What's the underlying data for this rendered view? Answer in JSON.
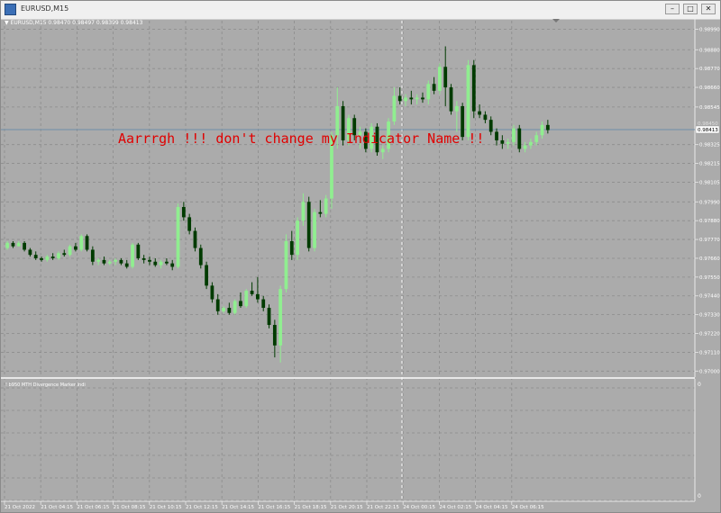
{
  "window": {
    "title": "EURUSD,M15",
    "min_label": "–",
    "max_label": "□",
    "close_label": "✕"
  },
  "chart_info": {
    "arrow": "▼",
    "text": "EURUSD,M15  0.98470 0.98497 0.98399 0.98413"
  },
  "message": "Aarrrgh !!! don't change my Indicator Name !!",
  "subwindow": {
    "title": "! b950 MTH Divergence Marker Indi",
    "scale_top": "0",
    "scale_bottom": "0"
  },
  "colors": {
    "background": "#ababab",
    "grid": "#8c8c8c",
    "bull": "#90ee90",
    "bear": "#003b00",
    "message": "#e00000",
    "price_line": "#6f8fa8"
  },
  "chart_data": {
    "type": "candlestick",
    "symbol": "EURUSD",
    "timeframe": "M15",
    "current_price": 0.98413,
    "price_tag_above": "0.98450",
    "yticks": [
      0.99,
      0.9888,
      0.9877,
      0.9866,
      0.98545,
      0.98325,
      0.98215,
      0.98105,
      0.9799,
      0.9788,
      0.9777,
      0.9766,
      0.9755,
      0.9744,
      0.9733,
      0.9722,
      0.9711,
      0.97
    ],
    "ytick_labels": [
      "0.98990",
      "0.98880",
      "0.98770",
      "0.98660",
      "0.98545",
      "0.98325",
      "0.98215",
      "0.98105",
      "0.97990",
      "0.97880",
      "0.97770",
      "0.97660",
      "0.97550",
      "0.97440",
      "0.97330",
      "0.97220",
      "0.97110",
      "0.97000"
    ],
    "ylim": [
      0.9697,
      0.9905
    ],
    "xticks": [
      "21 Oct 2022",
      "21 Oct 04:15",
      "21 Oct 06:15",
      "21 Oct 08:15",
      "21 Oct 10:15",
      "21 Oct 12:15",
      "21 Oct 14:15",
      "21 Oct 16:15",
      "21 Oct 18:15",
      "21 Oct 20:15",
      "21 Oct 22:15",
      "24 Oct 00:15",
      "24 Oct 02:15",
      "24 Oct 04:15",
      "24 Oct 06:15"
    ],
    "candles": [
      [
        0.9772,
        0.9776,
        0.9771,
        0.9775
      ],
      [
        0.9775,
        0.9776,
        0.9772,
        0.9773
      ],
      [
        0.9773,
        0.9776,
        0.9773,
        0.9775
      ],
      [
        0.9775,
        0.9776,
        0.977,
        0.9771
      ],
      [
        0.9771,
        0.9772,
        0.9767,
        0.9768
      ],
      [
        0.9768,
        0.977,
        0.9765,
        0.9766
      ],
      [
        0.9766,
        0.9767,
        0.9764,
        0.9765
      ],
      [
        0.9765,
        0.9768,
        0.9764,
        0.9767
      ],
      [
        0.9767,
        0.9769,
        0.9765,
        0.9766
      ],
      [
        0.9766,
        0.977,
        0.9765,
        0.9769
      ],
      [
        0.9769,
        0.9771,
        0.9767,
        0.9768
      ],
      [
        0.9768,
        0.9774,
        0.9767,
        0.9773
      ],
      [
        0.9773,
        0.9775,
        0.977,
        0.9771
      ],
      [
        0.9771,
        0.978,
        0.977,
        0.9779
      ],
      [
        0.9779,
        0.978,
        0.977,
        0.9771
      ],
      [
        0.9771,
        0.9773,
        0.9762,
        0.9764
      ],
      [
        0.9764,
        0.9766,
        0.9762,
        0.9765
      ],
      [
        0.9765,
        0.9767,
        0.9762,
        0.9763
      ],
      [
        0.9763,
        0.9765,
        0.9762,
        0.9764
      ],
      [
        0.9764,
        0.9766,
        0.9762,
        0.9765
      ],
      [
        0.9765,
        0.9766,
        0.9762,
        0.9763
      ],
      [
        0.9763,
        0.9765,
        0.976,
        0.9761
      ],
      [
        0.9761,
        0.9775,
        0.976,
        0.9774
      ],
      [
        0.9774,
        0.9775,
        0.9765,
        0.9766
      ],
      [
        0.9766,
        0.9768,
        0.9763,
        0.9765
      ],
      [
        0.9765,
        0.9767,
        0.9762,
        0.9764
      ],
      [
        0.9764,
        0.9766,
        0.9761,
        0.9762
      ],
      [
        0.9762,
        0.9765,
        0.976,
        0.9764
      ],
      [
        0.9764,
        0.9766,
        0.9762,
        0.9763
      ],
      [
        0.9763,
        0.9765,
        0.9759,
        0.9761
      ],
      [
        0.9761,
        0.9798,
        0.976,
        0.9796
      ],
      [
        0.9796,
        0.9799,
        0.9788,
        0.979
      ],
      [
        0.979,
        0.9792,
        0.978,
        0.9782
      ],
      [
        0.9782,
        0.9784,
        0.977,
        0.9772
      ],
      [
        0.9772,
        0.9774,
        0.976,
        0.9762
      ],
      [
        0.9762,
        0.9764,
        0.9748,
        0.975
      ],
      [
        0.975,
        0.9752,
        0.974,
        0.9742
      ],
      [
        0.9742,
        0.9745,
        0.9733,
        0.9735
      ],
      [
        0.9735,
        0.9738,
        0.9734,
        0.9737
      ],
      [
        0.9737,
        0.974,
        0.9733,
        0.9734
      ],
      [
        0.9734,
        0.9742,
        0.9733,
        0.9741
      ],
      [
        0.9741,
        0.9746,
        0.9737,
        0.9738
      ],
      [
        0.9738,
        0.9748,
        0.9737,
        0.9747
      ],
      [
        0.9747,
        0.9752,
        0.9744,
        0.9745
      ],
      [
        0.9745,
        0.9755,
        0.974,
        0.9742
      ],
      [
        0.9742,
        0.9744,
        0.9735,
        0.9737
      ],
      [
        0.9737,
        0.9739,
        0.9725,
        0.9727
      ],
      [
        0.9727,
        0.973,
        0.9708,
        0.9715
      ],
      [
        0.9715,
        0.975,
        0.9705,
        0.9748
      ],
      [
        0.9748,
        0.978,
        0.9746,
        0.9776
      ],
      [
        0.9776,
        0.9782,
        0.9765,
        0.9768
      ],
      [
        0.9768,
        0.979,
        0.9765,
        0.9788
      ],
      [
        0.9788,
        0.9804,
        0.9785,
        0.9799
      ],
      [
        0.9799,
        0.9802,
        0.977,
        0.9772
      ],
      [
        0.9772,
        0.9795,
        0.977,
        0.9793
      ],
      [
        0.9793,
        0.98,
        0.979,
        0.9792
      ],
      [
        0.9792,
        0.9803,
        0.979,
        0.9801
      ],
      [
        0.9801,
        0.984,
        0.9795,
        0.9838
      ],
      [
        0.9838,
        0.9866,
        0.983,
        0.9855
      ],
      [
        0.9855,
        0.9858,
        0.9832,
        0.9835
      ],
      [
        0.9835,
        0.985,
        0.9832,
        0.9848
      ],
      [
        0.9848,
        0.985,
        0.9835,
        0.9838
      ],
      [
        0.9838,
        0.9843,
        0.983,
        0.984
      ],
      [
        0.984,
        0.9842,
        0.9828,
        0.983
      ],
      [
        0.983,
        0.9845,
        0.9828,
        0.9843
      ],
      [
        0.9843,
        0.9845,
        0.9826,
        0.9828
      ],
      [
        0.9828,
        0.9832,
        0.9824,
        0.983
      ],
      [
        0.983,
        0.9848,
        0.9828,
        0.9846
      ],
      [
        0.9846,
        0.9866,
        0.9844,
        0.9861
      ],
      [
        0.9861,
        0.9866,
        0.9856,
        0.9858
      ],
      [
        0.9858,
        0.9862,
        0.9855,
        0.986
      ],
      [
        0.986,
        0.9864,
        0.9856,
        0.9859
      ],
      [
        0.9859,
        0.9862,
        0.9856,
        0.986
      ],
      [
        0.986,
        0.9863,
        0.9857,
        0.9859
      ],
      [
        0.9859,
        0.987,
        0.9856,
        0.9868
      ],
      [
        0.9868,
        0.9872,
        0.9862,
        0.9864
      ],
      [
        0.9864,
        0.988,
        0.9862,
        0.9878
      ],
      [
        0.9878,
        0.989,
        0.9855,
        0.9866
      ],
      [
        0.9866,
        0.9868,
        0.985,
        0.9852
      ],
      [
        0.9852,
        0.9858,
        0.984,
        0.9855
      ],
      [
        0.9855,
        0.9857,
        0.9835,
        0.9837
      ],
      [
        0.9837,
        0.9882,
        0.9835,
        0.9879
      ],
      [
        0.9879,
        0.9882,
        0.9848,
        0.9852
      ],
      [
        0.9852,
        0.9856,
        0.9848,
        0.985
      ],
      [
        0.985,
        0.9852,
        0.9845,
        0.9847
      ],
      [
        0.9847,
        0.9849,
        0.9838,
        0.984
      ],
      [
        0.984,
        0.9842,
        0.9832,
        0.9835
      ],
      [
        0.9835,
        0.9838,
        0.983,
        0.9833
      ],
      [
        0.9833,
        0.9836,
        0.983,
        0.9834
      ],
      [
        0.9834,
        0.9844,
        0.9832,
        0.9842
      ],
      [
        0.9842,
        0.9844,
        0.9828,
        0.983
      ],
      [
        0.983,
        0.9834,
        0.9828,
        0.9832
      ],
      [
        0.9832,
        0.9836,
        0.983,
        0.9834
      ],
      [
        0.9834,
        0.984,
        0.9832,
        0.9838
      ],
      [
        0.9838,
        0.9846,
        0.9836,
        0.9844
      ],
      [
        0.9844,
        0.9847,
        0.9839,
        0.9841
      ]
    ]
  }
}
